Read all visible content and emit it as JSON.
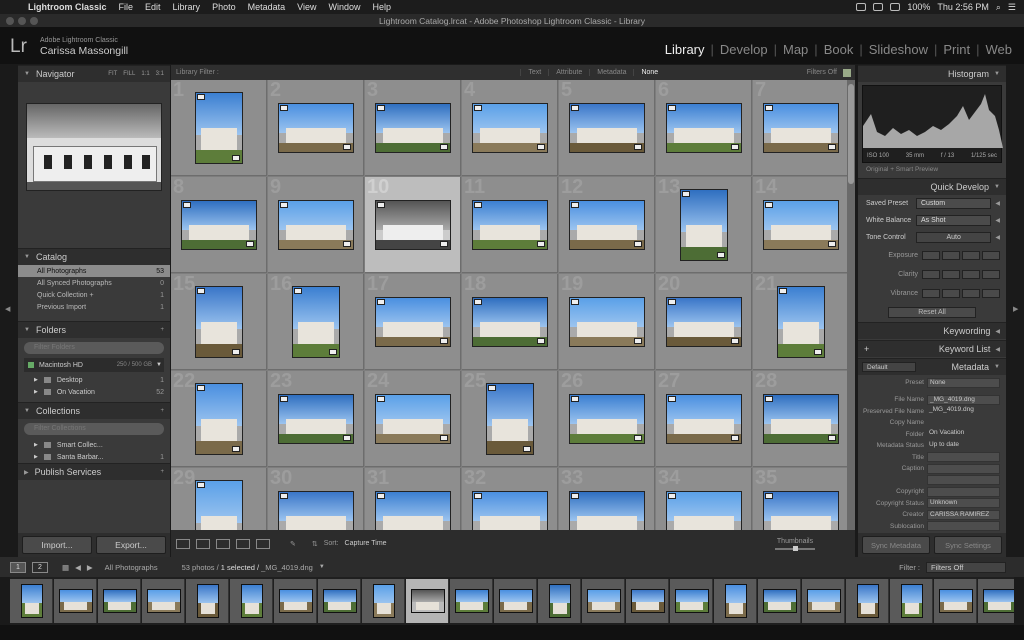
{
  "menubar": {
    "app_name": "Lightroom Classic",
    "items": [
      "File",
      "Edit",
      "Library",
      "Photo",
      "Metadata",
      "View",
      "Window",
      "Help"
    ],
    "battery": "100%",
    "time": "Thu 2:56 PM"
  },
  "window_title": "Lightroom Catalog.lrcat - Adobe Photoshop Lightroom Classic - Library",
  "identity": {
    "logo": "Lr",
    "app_line": "Adobe Lightroom Classic",
    "user": "Carissa Massongill"
  },
  "modules": [
    "Library",
    "Develop",
    "Map",
    "Book",
    "Slideshow",
    "Print",
    "Web"
  ],
  "left_panel": {
    "navigator": {
      "title": "Navigator",
      "zooms": [
        "FIT",
        "FILL",
        "1:1",
        "3:1"
      ]
    },
    "catalog": {
      "title": "Catalog",
      "rows": [
        {
          "label": "All Photographs",
          "count": "53"
        },
        {
          "label": "All Synced Photographs",
          "count": "0"
        },
        {
          "label": "Quick Collection +",
          "count": "1"
        },
        {
          "label": "Previous Import",
          "count": "1"
        }
      ]
    },
    "folders": {
      "title": "Folders",
      "filter_placeholder": "Filter Folders",
      "volume": {
        "name": "Macintosh HD",
        "size": "250 / 500 GB"
      },
      "rows": [
        {
          "label": "Desktop",
          "count": "1"
        },
        {
          "label": "On Vacation",
          "count": "52"
        }
      ]
    },
    "collections": {
      "title": "Collections",
      "filter_placeholder": "Filter Collections",
      "rows": [
        {
          "label": "Smart Collec...",
          "count": ""
        },
        {
          "label": "Santa Barbar...",
          "count": "1"
        }
      ]
    },
    "publish": {
      "title": "Publish Services"
    },
    "import_label": "Import...",
    "export_label": "Export..."
  },
  "filter_bar": {
    "label": "Library Filter :",
    "options": [
      "Text",
      "Attribute",
      "Metadata",
      "None"
    ],
    "active": "None",
    "status": "Filters Off"
  },
  "grid": {
    "cells": [
      {
        "n": "1",
        "p": "v"
      },
      {
        "n": "2",
        "p": "h"
      },
      {
        "n": "3",
        "p": "h"
      },
      {
        "n": "4",
        "p": "h"
      },
      {
        "n": "5",
        "p": "h"
      },
      {
        "n": "6",
        "p": "h"
      },
      {
        "n": "7",
        "p": "h"
      },
      {
        "n": "8",
        "p": "h"
      },
      {
        "n": "9",
        "p": "h"
      },
      {
        "n": "10",
        "p": "bw",
        "sel": true
      },
      {
        "n": "11",
        "p": "h"
      },
      {
        "n": "12",
        "p": "h"
      },
      {
        "n": "13",
        "p": "v"
      },
      {
        "n": "14",
        "p": "h"
      },
      {
        "n": "15",
        "p": "v"
      },
      {
        "n": "16",
        "p": "v"
      },
      {
        "n": "17",
        "p": "h"
      },
      {
        "n": "18",
        "p": "h"
      },
      {
        "n": "19",
        "p": "h"
      },
      {
        "n": "20",
        "p": "h"
      },
      {
        "n": "21",
        "p": "v"
      },
      {
        "n": "22",
        "p": "v"
      },
      {
        "n": "23",
        "p": "h"
      },
      {
        "n": "24",
        "p": "h"
      },
      {
        "n": "25",
        "p": "v"
      },
      {
        "n": "26",
        "p": "h"
      },
      {
        "n": "27",
        "p": "h"
      },
      {
        "n": "28",
        "p": "h"
      },
      {
        "n": "29",
        "p": "v"
      },
      {
        "n": "30",
        "p": "h"
      },
      {
        "n": "31",
        "p": "h"
      },
      {
        "n": "32",
        "p": "h"
      },
      {
        "n": "33",
        "p": "h"
      },
      {
        "n": "34",
        "p": "h"
      },
      {
        "n": "35",
        "p": "h"
      }
    ]
  },
  "toolbar": {
    "sort_label": "Sort:",
    "sort_value": "Capture Time",
    "thumbnails_label": "Thumbnails"
  },
  "right_panel": {
    "histogram": {
      "title": "Histogram",
      "exif": [
        "ISO 100",
        "35 mm",
        "f / 13",
        "1/125 sec"
      ],
      "preview_note": "Original + Smart Preview"
    },
    "quick_develop": {
      "title": "Quick Develop",
      "saved_preset_label": "Saved Preset",
      "saved_preset_value": "Custom",
      "white_balance_label": "White Balance",
      "white_balance_value": "As Shot",
      "tone_control_label": "Tone Control",
      "auto_label": "Auto",
      "exposure_label": "Exposure",
      "clarity_label": "Clarity",
      "vibrance_label": "Vibrance",
      "reset_label": "Reset All"
    },
    "keywording": "Keywording",
    "keyword_list": "Keyword List",
    "metadata": {
      "title": "Metadata",
      "preset_selector": "Default",
      "preset_label": "Preset",
      "preset_value": "None",
      "rows": [
        {
          "label": "File Name",
          "value": "_MG_4019.dng",
          "box": true
        },
        {
          "label": "Preserved File Name",
          "value": "_MG_4019.dng",
          "box": false
        },
        {
          "label": "Copy Name",
          "value": "",
          "box": false
        },
        {
          "label": "Folder",
          "value": "On Vacation",
          "box": false
        },
        {
          "label": "Metadata Status",
          "value": "Up to date",
          "box": false
        },
        {
          "label": "Title",
          "value": "",
          "box": true
        },
        {
          "label": "Caption",
          "value": "",
          "box": true
        },
        {
          "label": "",
          "value": "",
          "box": true
        },
        {
          "label": "Copyright",
          "value": "",
          "box": true
        },
        {
          "label": "Copyright Status",
          "value": "Unknown",
          "box": true
        },
        {
          "label": "Creator",
          "value": "CARISSA RAMIREZ",
          "box": true
        },
        {
          "label": "Sublocation",
          "value": "",
          "box": true
        }
      ]
    },
    "sync_metadata": "Sync Metadata",
    "sync_settings": "Sync Settings"
  },
  "filmstrip_bar": {
    "pages": [
      "1",
      "2"
    ],
    "source": "All Photographs",
    "count": "53 photos /",
    "selected": "1 selected /",
    "filename": "_MG_4019.dng",
    "filter_label": "Filter :",
    "filter_value": "Filters Off"
  },
  "filmstrip": {
    "selected_index": 9,
    "count": 23
  }
}
